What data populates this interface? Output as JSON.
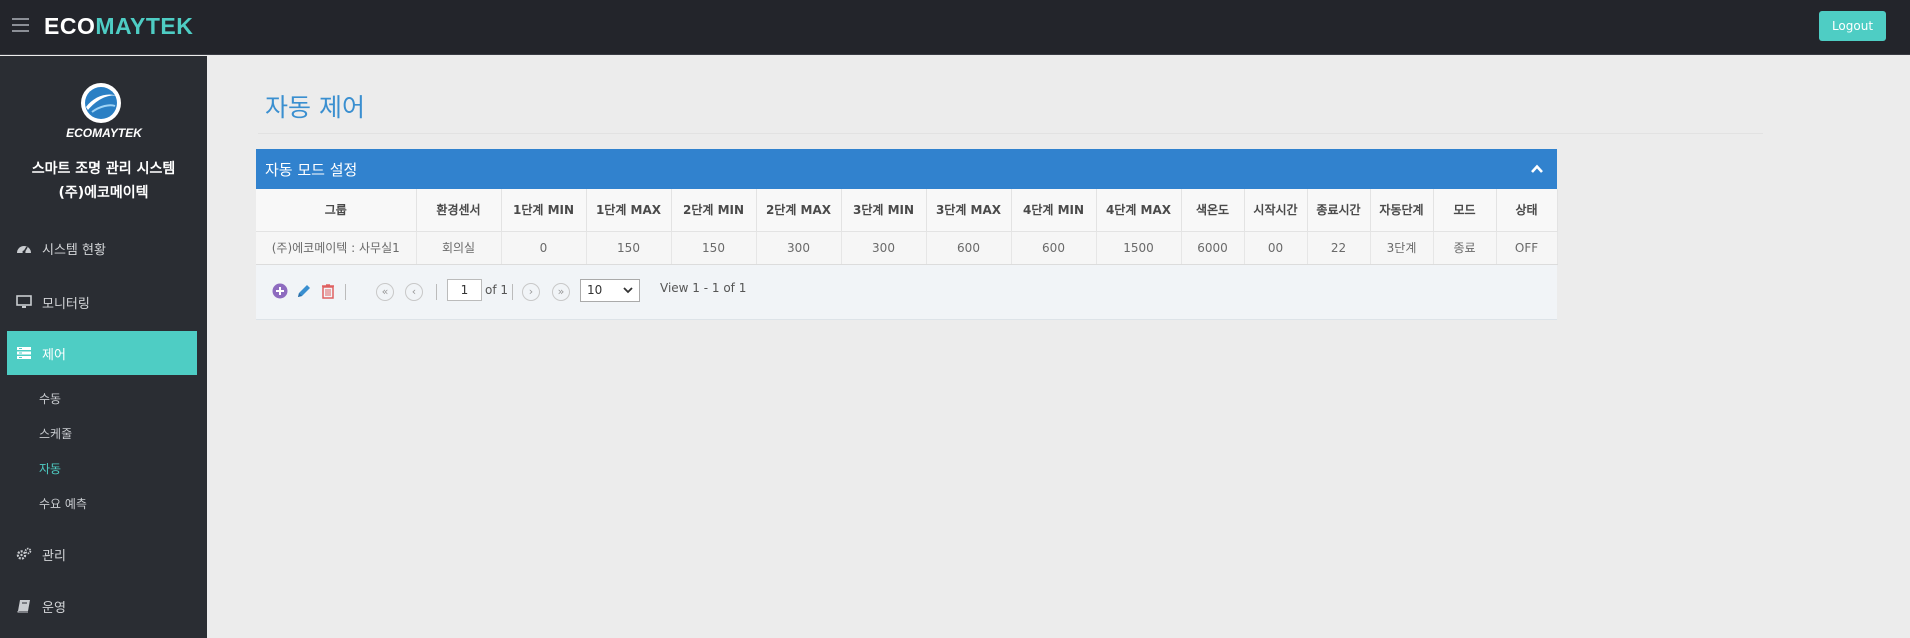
{
  "brand": {
    "part1": "ECO",
    "part2": "MAYTEK"
  },
  "header": {
    "logout_label": "Logout"
  },
  "sidebar": {
    "logo_text": "ECOMAYTEK",
    "system_title": "스마트 조명 관리 시스템",
    "company": "(주)에코메이텍",
    "nav": [
      {
        "label": "시스템 현황",
        "icon": "dashboard-icon"
      },
      {
        "label": "모니터링",
        "icon": "monitor-icon"
      },
      {
        "label": "제어",
        "icon": "control-icon",
        "active": true
      },
      {
        "label": "관리",
        "icon": "gears-icon"
      },
      {
        "label": "운영",
        "icon": "book-icon"
      }
    ],
    "sub_items": [
      "수동",
      "스케줄",
      "자동",
      "수요 예측"
    ],
    "active_sub": "자동"
  },
  "main": {
    "page_title": "자동 제어",
    "panel_title": "자동 모드 설정",
    "table": {
      "columns": [
        "그룹",
        "환경센서",
        "1단계 MIN",
        "1단계 MAX",
        "2단계 MIN",
        "2단계 MAX",
        "3단계 MIN",
        "3단계 MAX",
        "4단계 MIN",
        "4단계 MAX",
        "색온도",
        "시작시간",
        "종료시간",
        "자동단계",
        "모드",
        "상태"
      ],
      "rows": [
        [
          "(주)에코메이텍 : 사무실1",
          "회의실",
          "0",
          "150",
          "150",
          "300",
          "300",
          "600",
          "600",
          "1500",
          "6000",
          "00",
          "22",
          "3단계",
          "종료",
          "OFF"
        ]
      ]
    },
    "pager": {
      "page": "1",
      "of_label": "of 1",
      "rows_per_page": "10",
      "view_label": "View 1 - 1 of 1"
    }
  },
  "colors": {
    "accent": "#4ecdc4",
    "panel_header": "#3182ce",
    "topbar": "#23252b",
    "sidebar": "#2a2d33",
    "title": "#3a8fd0"
  }
}
